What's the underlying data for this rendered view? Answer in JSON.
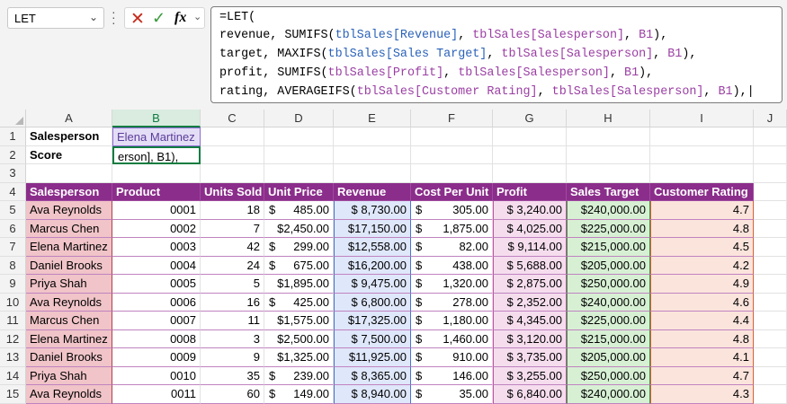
{
  "name_box": "LET",
  "formula_lines": [
    [
      {
        "t": "=LET("
      }
    ],
    [
      {
        "t": "revenue, SUMIFS("
      },
      {
        "t": "tblSales[Revenue]",
        "c": "ref"
      },
      {
        "t": ", "
      },
      {
        "t": "tblSales[Salesperson]",
        "c": "ref2"
      },
      {
        "t": ", "
      },
      {
        "t": "B1",
        "c": "ref2"
      },
      {
        "t": "),"
      }
    ],
    [
      {
        "t": "target, MAXIFS("
      },
      {
        "t": "tblSales[Sales Target]",
        "c": "ref"
      },
      {
        "t": ", "
      },
      {
        "t": "tblSales[Salesperson]",
        "c": "ref2"
      },
      {
        "t": ", "
      },
      {
        "t": "B1",
        "c": "ref2"
      },
      {
        "t": "),"
      }
    ],
    [
      {
        "t": "profit, SUMIFS("
      },
      {
        "t": "tblSales[Profit]",
        "c": "ref2"
      },
      {
        "t": ", "
      },
      {
        "t": "tblSales[Salesperson]",
        "c": "ref2"
      },
      {
        "t": ", "
      },
      {
        "t": "B1",
        "c": "ref2"
      },
      {
        "t": "),"
      }
    ],
    [
      {
        "t": "rating, AVERAGEIFS("
      },
      {
        "t": "tblSales[Customer Rating]",
        "c": "ref2"
      },
      {
        "t": ", "
      },
      {
        "t": "tblSales[Salesperson]",
        "c": "ref2"
      },
      {
        "t": ", "
      },
      {
        "t": "B1",
        "c": "ref2"
      },
      {
        "t": "),|"
      }
    ]
  ],
  "columns": [
    "A",
    "B",
    "C",
    "D",
    "E",
    "F",
    "G",
    "H",
    "I",
    "J"
  ],
  "selected_column": "B",
  "rows": [
    "1",
    "2",
    "3",
    "4",
    "5",
    "6",
    "7",
    "8",
    "9",
    "10",
    "11",
    "12",
    "13",
    "14",
    "15"
  ],
  "cells": {
    "A1": "Salesperson",
    "B1": "Elena Martinez",
    "A2": "Score",
    "B2": "erson], B1),"
  },
  "table": {
    "headers": [
      "Salesperson",
      "Product",
      "Units Sold",
      "Unit Price",
      "Revenue",
      "Cost Per Unit",
      "Profit",
      "Sales Target",
      "Customer Rating"
    ],
    "rows": [
      [
        "Ava Reynolds",
        "0001",
        "18",
        "485.00",
        "$ 8,730.00",
        "305.00",
        "$ 3,240.00",
        "$240,000.00",
        "4.7"
      ],
      [
        "Marcus Chen",
        "0002",
        "7",
        "$2,450.00",
        "$17,150.00",
        "1,875.00",
        "$ 4,025.00",
        "$225,000.00",
        "4.8"
      ],
      [
        "Elena Martinez",
        "0003",
        "42",
        "299.00",
        "$12,558.00",
        "82.00",
        "$ 9,114.00",
        "$215,000.00",
        "4.5"
      ],
      [
        "Daniel Brooks",
        "0004",
        "24",
        "675.00",
        "$16,200.00",
        "438.00",
        "$ 5,688.00",
        "$205,000.00",
        "4.2"
      ],
      [
        "Priya Shah",
        "0005",
        "5",
        "$1,895.00",
        "$ 9,475.00",
        "1,320.00",
        "$ 2,875.00",
        "$250,000.00",
        "4.9"
      ],
      [
        "Ava Reynolds",
        "0006",
        "16",
        "425.00",
        "$ 6,800.00",
        "278.00",
        "$ 2,352.00",
        "$240,000.00",
        "4.6"
      ],
      [
        "Marcus Chen",
        "0007",
        "11",
        "$1,575.00",
        "$17,325.00",
        "1,180.00",
        "$ 4,345.00",
        "$225,000.00",
        "4.4"
      ],
      [
        "Elena Martinez",
        "0008",
        "3",
        "$2,500.00",
        "$ 7,500.00",
        "1,460.00",
        "$ 3,120.00",
        "$215,000.00",
        "4.8"
      ],
      [
        "Daniel Brooks",
        "0009",
        "9",
        "$1,325.00",
        "$11,925.00",
        "910.00",
        "$ 3,735.00",
        "$205,000.00",
        "4.1"
      ],
      [
        "Priya Shah",
        "0010",
        "35",
        "239.00",
        "$ 8,365.00",
        "146.00",
        "$ 3,255.00",
        "$250,000.00",
        "4.7"
      ],
      [
        "Ava Reynolds",
        "0011",
        "60",
        "149.00",
        "$ 8,940.00",
        "35.00",
        "$ 6,840.00",
        "$240,000.00",
        "4.3"
      ]
    ]
  },
  "colors": {
    "header_fill": "#8b2d8b",
    "salesperson_fill": "#f0c4c8",
    "revenue_fill": "#dfe7fa",
    "profit_fill": "#f5ddee",
    "target_fill": "#d7f0d4",
    "rating_fill": "#fbe4dc",
    "accent_green": "#107c41"
  }
}
